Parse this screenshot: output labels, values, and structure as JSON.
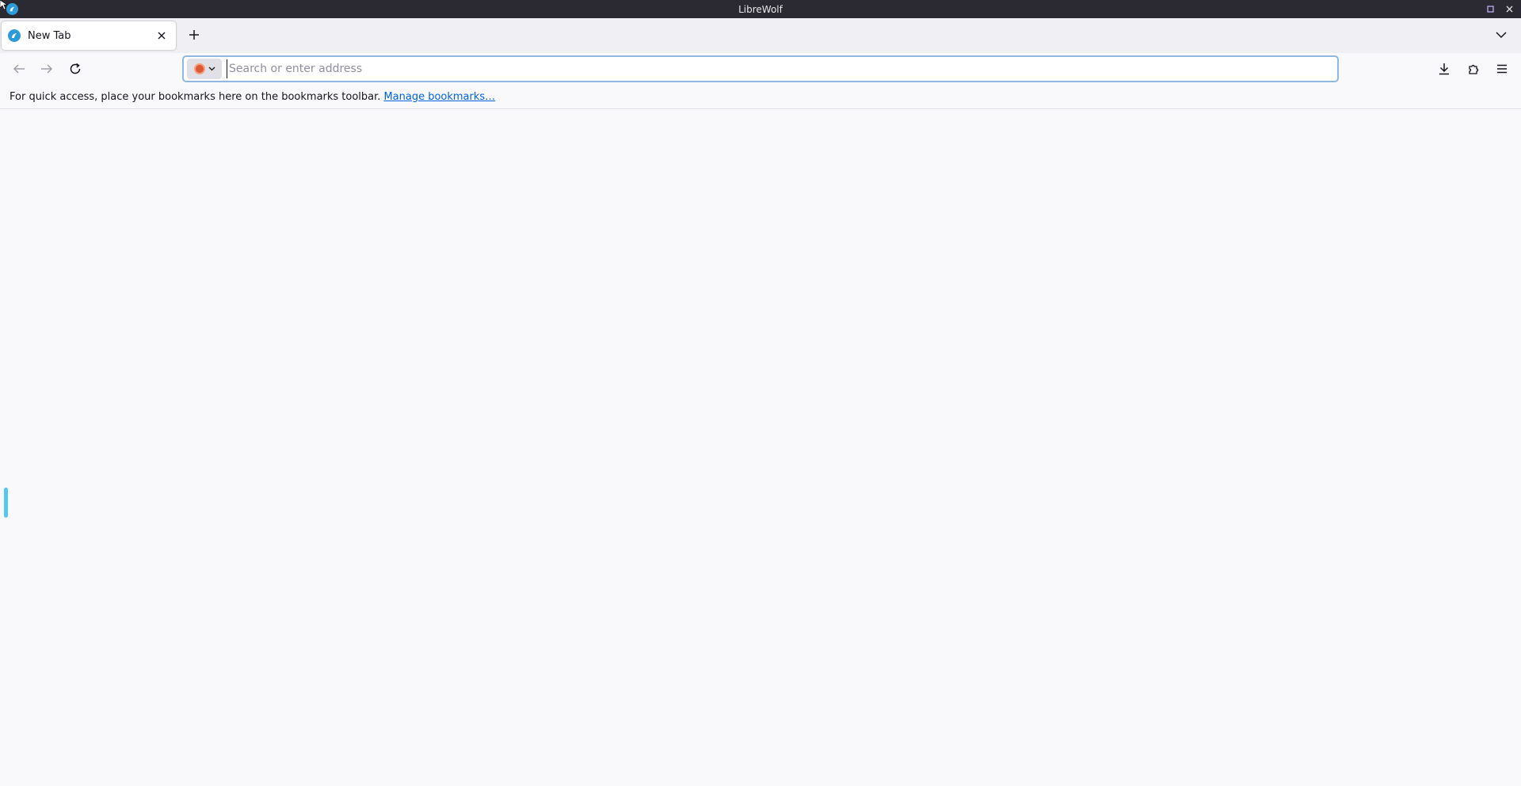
{
  "window": {
    "title": "LibreWolf"
  },
  "tabs": [
    {
      "label": "New Tab",
      "active": true
    }
  ],
  "urlbar": {
    "placeholder": "Search or enter address",
    "value": "",
    "search_engine_icon": "duckduckgo-icon"
  },
  "bookmarks_toolbar": {
    "message": "For quick access, place your bookmarks here on the bookmarks toolbar.",
    "link": "Manage bookmarks…"
  },
  "colors": {
    "titlebar": "#2b2a33",
    "accent": "#2e9bd9",
    "link": "#0061e0",
    "sidebar_handle": "#54c8f0"
  }
}
